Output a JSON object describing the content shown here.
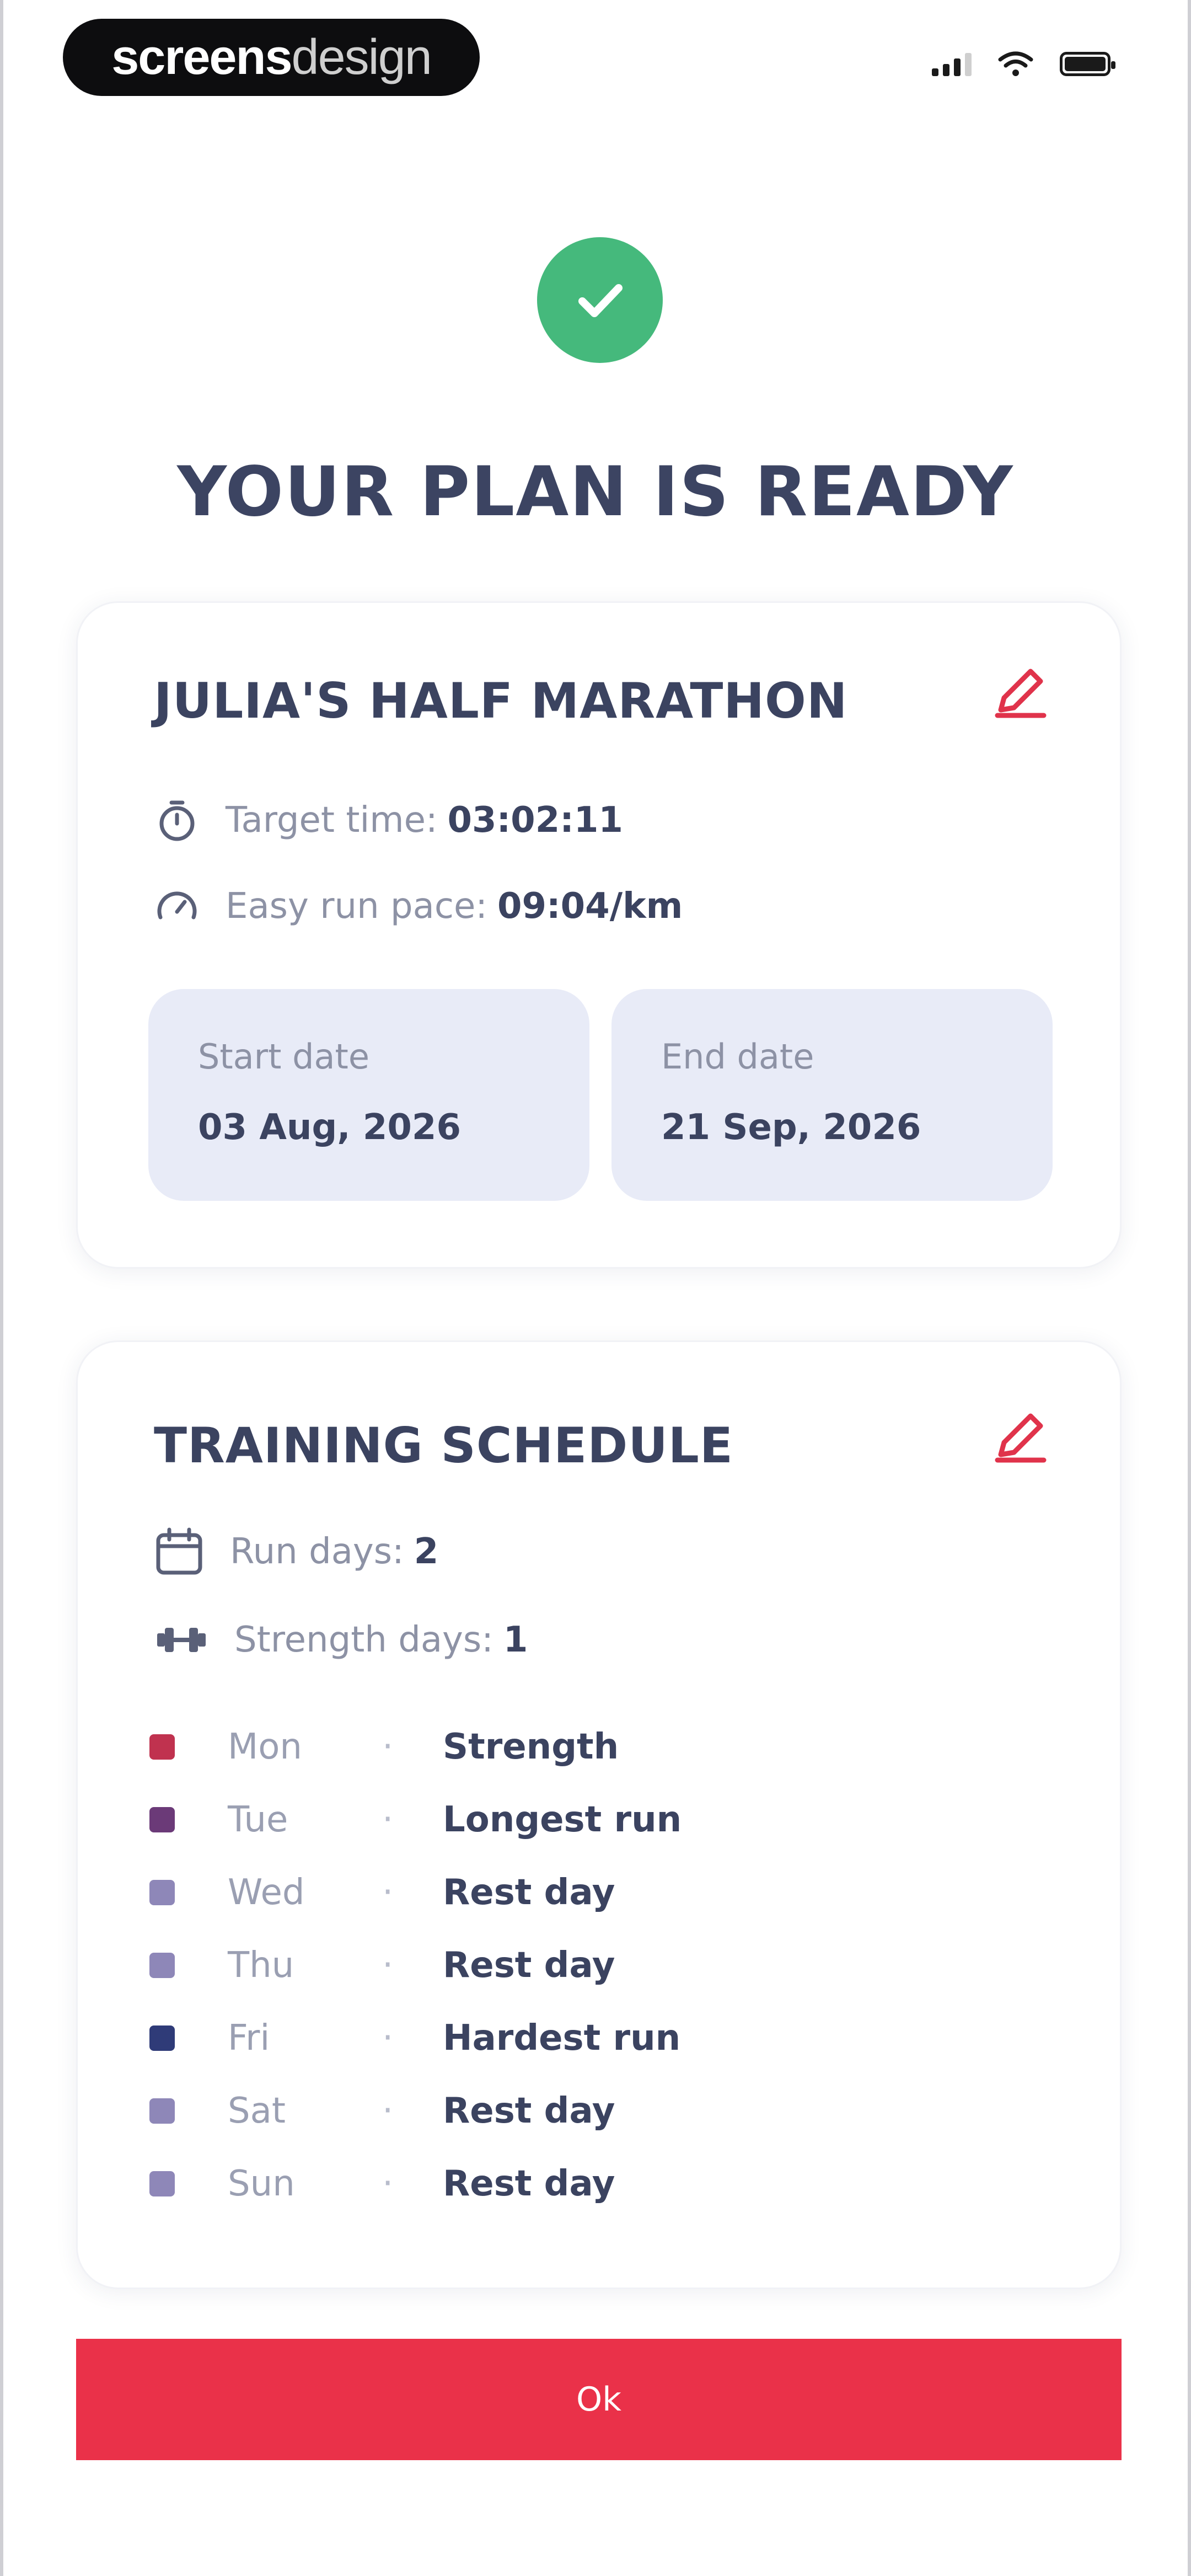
{
  "status_bar": {
    "brand_bold": "screens",
    "brand_light": "design"
  },
  "header": {
    "title": "YOUR PLAN IS READY"
  },
  "plan": {
    "title": "JULIA'S HALF MARATHON",
    "target_time_label": "Target time:",
    "target_time_value": "03:02:11",
    "easy_pace_label": "Easy run pace:",
    "easy_pace_value": "09:04/km",
    "start_date_label": "Start date",
    "start_date_value": "03 Aug, 2026",
    "end_date_label": "End date",
    "end_date_value": "21 Sep, 2026"
  },
  "schedule": {
    "title": "TRAINING SCHEDULE",
    "run_days_label": "Run days:",
    "run_days_value": "2",
    "strength_days_label": "Strength days:",
    "strength_days_value": "1",
    "separator": "·",
    "days": [
      {
        "day": "Mon",
        "activity": "Strength",
        "color": "#c0324f"
      },
      {
        "day": "Tue",
        "activity": "Longest run",
        "color": "#6b3a78"
      },
      {
        "day": "Wed",
        "activity": "Rest day",
        "color": "#8e87b8"
      },
      {
        "day": "Thu",
        "activity": "Rest day",
        "color": "#8e87b8"
      },
      {
        "day": "Fri",
        "activity": "Hardest run",
        "color": "#2f3b78"
      },
      {
        "day": "Sat",
        "activity": "Rest day",
        "color": "#8e87b8"
      },
      {
        "day": "Sun",
        "activity": "Rest day",
        "color": "#8e87b8"
      }
    ]
  },
  "footer": {
    "ok_label": "Ok"
  },
  "colors": {
    "accent": "#ea3149",
    "success": "#45b97c",
    "title": "#3c4462"
  }
}
